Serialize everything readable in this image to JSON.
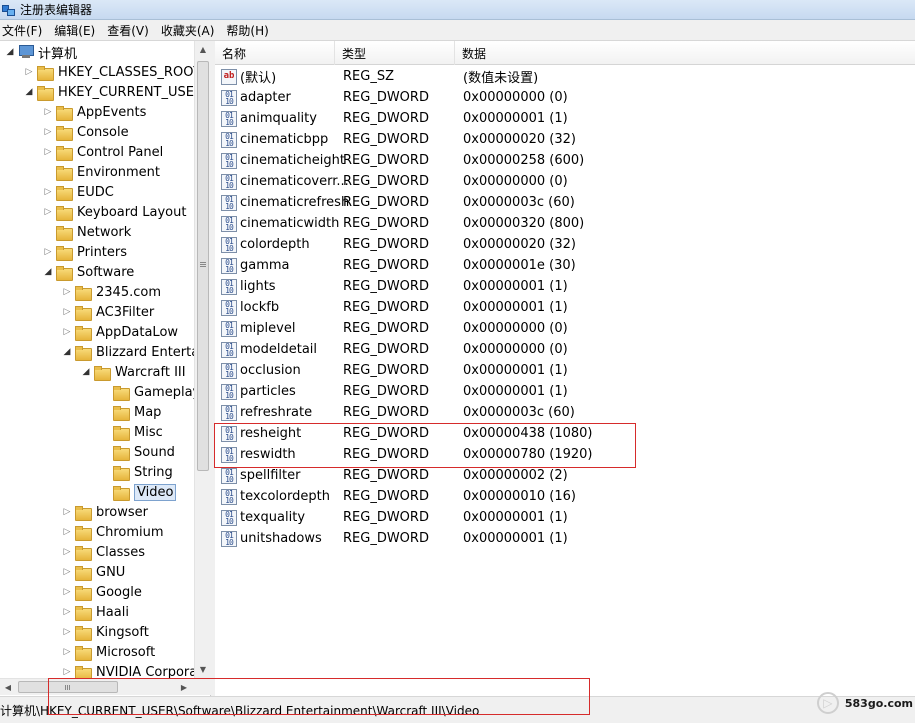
{
  "window": {
    "title": "注册表编辑器"
  },
  "menu": [
    "文件(F)",
    "编辑(E)",
    "查看(V)",
    "收藏夹(A)",
    "帮助(H)"
  ],
  "tree": [
    {
      "label": "计算机",
      "level": 0,
      "state": "open",
      "icon": "computer-icon"
    },
    {
      "label": "HKEY_CLASSES_ROOT",
      "level": 1,
      "state": "closed"
    },
    {
      "label": "HKEY_CURRENT_USER",
      "level": 1,
      "state": "open"
    },
    {
      "label": "AppEvents",
      "level": 2,
      "state": "closed"
    },
    {
      "label": "Console",
      "level": 2,
      "state": "closed"
    },
    {
      "label": "Control Panel",
      "level": 2,
      "state": "closed"
    },
    {
      "label": "Environment",
      "level": 2,
      "state": "none"
    },
    {
      "label": "EUDC",
      "level": 2,
      "state": "closed"
    },
    {
      "label": "Keyboard Layout",
      "level": 2,
      "state": "closed"
    },
    {
      "label": "Network",
      "level": 2,
      "state": "none"
    },
    {
      "label": "Printers",
      "level": 2,
      "state": "closed"
    },
    {
      "label": "Software",
      "level": 2,
      "state": "open"
    },
    {
      "label": "2345.com",
      "level": 3,
      "state": "closed"
    },
    {
      "label": "AC3Filter",
      "level": 3,
      "state": "closed"
    },
    {
      "label": "AppDataLow",
      "level": 3,
      "state": "closed"
    },
    {
      "label": "Blizzard Entertai",
      "level": 3,
      "state": "open"
    },
    {
      "label": "Warcraft III",
      "level": 4,
      "state": "open"
    },
    {
      "label": "Gameplay",
      "level": 5,
      "state": "none"
    },
    {
      "label": "Map",
      "level": 5,
      "state": "none"
    },
    {
      "label": "Misc",
      "level": 5,
      "state": "none"
    },
    {
      "label": "Sound",
      "level": 5,
      "state": "none"
    },
    {
      "label": "String",
      "level": 5,
      "state": "none"
    },
    {
      "label": "Video",
      "level": 5,
      "state": "none",
      "selected": true
    },
    {
      "label": "browser",
      "level": 3,
      "state": "closed"
    },
    {
      "label": "Chromium",
      "level": 3,
      "state": "closed"
    },
    {
      "label": "Classes",
      "level": 3,
      "state": "closed"
    },
    {
      "label": "GNU",
      "level": 3,
      "state": "closed"
    },
    {
      "label": "Google",
      "level": 3,
      "state": "closed"
    },
    {
      "label": "Haali",
      "level": 3,
      "state": "closed"
    },
    {
      "label": "Kingsoft",
      "level": 3,
      "state": "closed"
    },
    {
      "label": "Microsoft",
      "level": 3,
      "state": "closed"
    },
    {
      "label": "NVIDIA Corpora",
      "level": 3,
      "state": "closed"
    }
  ],
  "columns": {
    "name": "名称",
    "type": "类型",
    "data": "数据"
  },
  "values": [
    {
      "name": "(默认)",
      "type": "REG_SZ",
      "data": "(数值未设置)",
      "icon": "string-value-icon"
    },
    {
      "name": "adapter",
      "type": "REG_DWORD",
      "data": "0x00000000 (0)",
      "icon": "binary-value-icon"
    },
    {
      "name": "animquality",
      "type": "REG_DWORD",
      "data": "0x00000001 (1)",
      "icon": "binary-value-icon"
    },
    {
      "name": "cinematicbpp",
      "type": "REG_DWORD",
      "data": "0x00000020 (32)",
      "icon": "binary-value-icon"
    },
    {
      "name": "cinematicheight",
      "type": "REG_DWORD",
      "data": "0x00000258 (600)",
      "icon": "binary-value-icon"
    },
    {
      "name": "cinematicoverr...",
      "type": "REG_DWORD",
      "data": "0x00000000 (0)",
      "icon": "binary-value-icon"
    },
    {
      "name": "cinematicrefresh",
      "type": "REG_DWORD",
      "data": "0x0000003c (60)",
      "icon": "binary-value-icon"
    },
    {
      "name": "cinematicwidth",
      "type": "REG_DWORD",
      "data": "0x00000320 (800)",
      "icon": "binary-value-icon"
    },
    {
      "name": "colordepth",
      "type": "REG_DWORD",
      "data": "0x00000020 (32)",
      "icon": "binary-value-icon"
    },
    {
      "name": "gamma",
      "type": "REG_DWORD",
      "data": "0x0000001e (30)",
      "icon": "binary-value-icon"
    },
    {
      "name": "lights",
      "type": "REG_DWORD",
      "data": "0x00000001 (1)",
      "icon": "binary-value-icon"
    },
    {
      "name": "lockfb",
      "type": "REG_DWORD",
      "data": "0x00000001 (1)",
      "icon": "binary-value-icon"
    },
    {
      "name": "miplevel",
      "type": "REG_DWORD",
      "data": "0x00000000 (0)",
      "icon": "binary-value-icon"
    },
    {
      "name": "modeldetail",
      "type": "REG_DWORD",
      "data": "0x00000000 (0)",
      "icon": "binary-value-icon"
    },
    {
      "name": "occlusion",
      "type": "REG_DWORD",
      "data": "0x00000001 (1)",
      "icon": "binary-value-icon"
    },
    {
      "name": "particles",
      "type": "REG_DWORD",
      "data": "0x00000001 (1)",
      "icon": "binary-value-icon"
    },
    {
      "name": "refreshrate",
      "type": "REG_DWORD",
      "data": "0x0000003c (60)",
      "icon": "binary-value-icon"
    },
    {
      "name": "resheight",
      "type": "REG_DWORD",
      "data": "0x00000438 (1080)",
      "icon": "binary-value-icon"
    },
    {
      "name": "reswidth",
      "type": "REG_DWORD",
      "data": "0x00000780 (1920)",
      "icon": "binary-value-icon"
    },
    {
      "name": "spellfilter",
      "type": "REG_DWORD",
      "data": "0x00000002 (2)",
      "icon": "binary-value-icon"
    },
    {
      "name": "texcolordepth",
      "type": "REG_DWORD",
      "data": "0x00000010 (16)",
      "icon": "binary-value-icon"
    },
    {
      "name": "texquality",
      "type": "REG_DWORD",
      "data": "0x00000001 (1)",
      "icon": "binary-value-icon"
    },
    {
      "name": "unitshadows",
      "type": "REG_DWORD",
      "data": "0x00000001 (1)",
      "icon": "binary-value-icon"
    }
  ],
  "status": {
    "path": "计算机\\HKEY_CURRENT_USER\\Software\\Blizzard Entertainment\\Warcraft III\\Video"
  },
  "watermark": {
    "text": "583go.com"
  },
  "colors": {
    "annotation": "#d62b2b",
    "selection": "#dde9f8",
    "folder": "#e6b43c"
  }
}
